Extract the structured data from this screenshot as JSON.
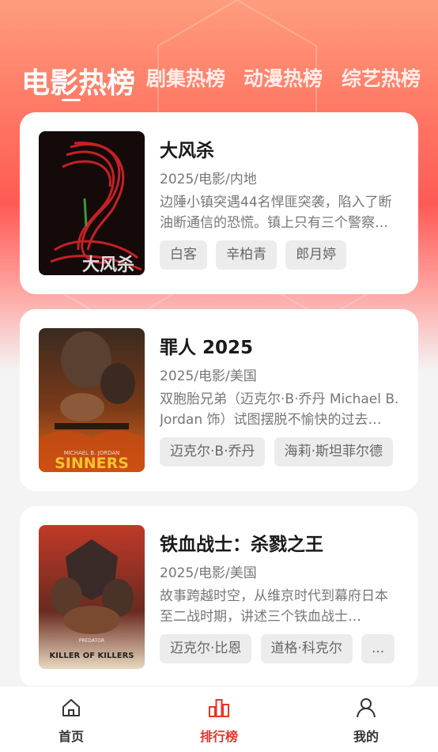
{
  "colors": {
    "accent": "#e8322b",
    "header_gradient_top": "#ff9d7e",
    "header_gradient_mid": "#ff5a55"
  },
  "tabs": [
    {
      "label": "电影热榜",
      "active": true
    },
    {
      "label": "剧集热榜",
      "active": false
    },
    {
      "label": "动漫热榜",
      "active": false
    },
    {
      "label": "综艺热榜",
      "active": false
    }
  ],
  "movies": [
    {
      "title": "大风杀",
      "meta": "2025/电影/内地",
      "desc": "边陲小镇突遇44名悍匪突袭，陷入了断油断通信的恐慌。镇上只有三个警察…",
      "tags": [
        "白客",
        "辛柏青",
        "郎月婷"
      ],
      "poster_text": "大风杀"
    },
    {
      "title": "罪人 2025",
      "meta": "2025/电影/美国",
      "desc": "双胞胎兄弟（迈克尔·B·乔丹 Michael B. Jordan 饰）试图摆脱不愉快的过去…",
      "tags": [
        "迈克尔·B·乔丹",
        "海莉·斯坦菲尔德"
      ],
      "poster_text": "SINNERS",
      "poster_subtext": "MICHAEL B. JORDAN"
    },
    {
      "title": "铁血战士：杀戮之王",
      "meta": "2025/电影/美国",
      "desc": "故事跨越时空，从维京时代到幕府日本至二战时期，讲述三个铁血战士…",
      "tags": [
        "迈克尔·比恩",
        "道格·科克尔",
        "..."
      ],
      "poster_text": "KILLER OF KILLERS",
      "poster_subtext": "PREDATOR"
    }
  ],
  "bottom_nav": [
    {
      "label": "首页",
      "icon": "home-icon",
      "active": false
    },
    {
      "label": "排行榜",
      "icon": "chart-icon",
      "active": true
    },
    {
      "label": "我的",
      "icon": "user-icon",
      "active": false
    }
  ]
}
